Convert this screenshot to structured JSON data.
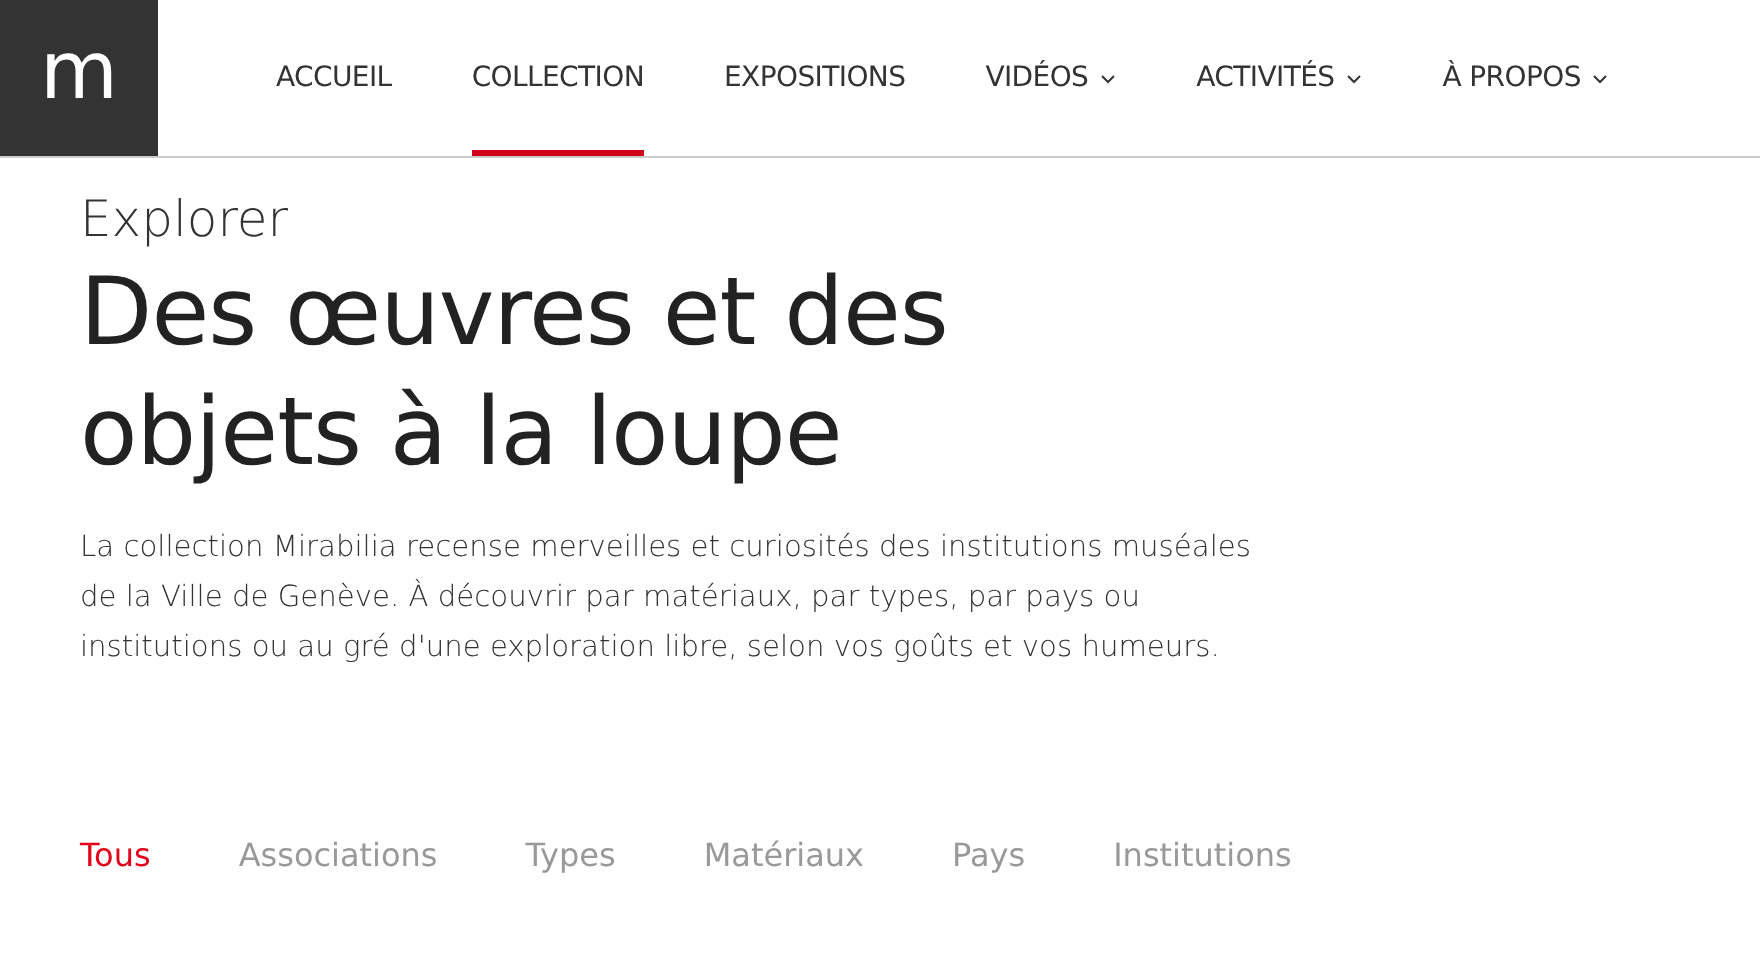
{
  "logo": {
    "text": "m"
  },
  "nav": [
    {
      "label": "ACCUEIL",
      "selected": false,
      "dropdown": false
    },
    {
      "label": "COLLECTION",
      "selected": true,
      "dropdown": false
    },
    {
      "label": "EXPOSITIONS",
      "selected": false,
      "dropdown": false
    },
    {
      "label": "VIDÉOS",
      "selected": false,
      "dropdown": true
    },
    {
      "label": "ACTIVITÉS",
      "selected": false,
      "dropdown": true
    },
    {
      "label": "À PROPOS",
      "selected": false,
      "dropdown": true
    }
  ],
  "eyebrow": "Explorer",
  "heading": "Des œuvres et des objets à la loupe",
  "intro": "La collection Mirabilia recense merveilles et curiosités des institutions muséales de la Ville de Genève. À découvrir par matériaux, par types, par pays ou institutions ou au gré d'une exploration libre, selon vos goûts et vos humeurs.",
  "filters": [
    {
      "label": "Tous",
      "selected": true
    },
    {
      "label": "Associations",
      "selected": false
    },
    {
      "label": "Types",
      "selected": false
    },
    {
      "label": "Matériaux",
      "selected": false
    },
    {
      "label": "Pays",
      "selected": false
    },
    {
      "label": "Institutions",
      "selected": false
    }
  ]
}
